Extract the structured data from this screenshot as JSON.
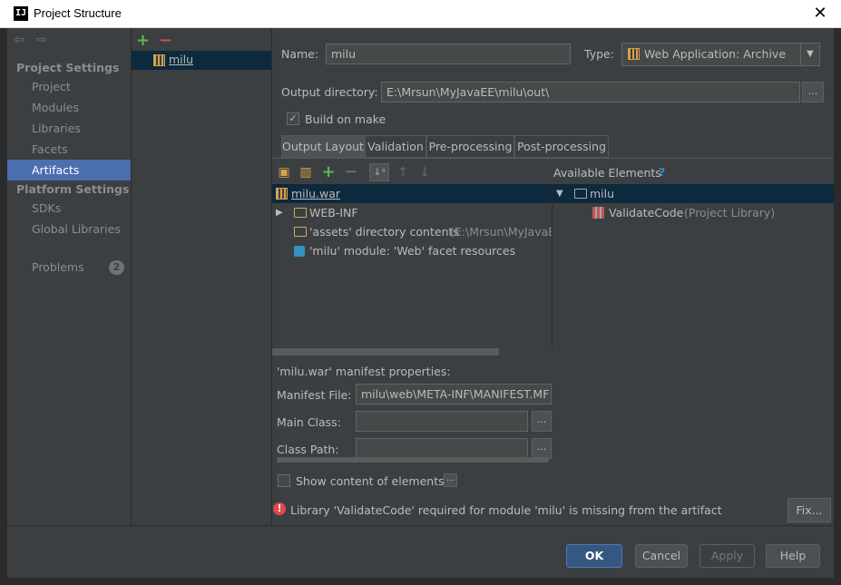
{
  "window": {
    "title": "Project Structure",
    "app_icon": "intellij-icon"
  },
  "sidebar": {
    "project_settings": "Project Settings",
    "items_project": [
      "Project",
      "Modules",
      "Libraries",
      "Facets",
      "Artifacts"
    ],
    "platform_settings": "Platform Settings",
    "items_platform": [
      "SDKs",
      "Global Libraries"
    ],
    "problems_label": "Problems",
    "problems_count": "2",
    "selected": "Artifacts"
  },
  "artifacts": {
    "add": "+",
    "remove": "−",
    "list": [
      "milu"
    ]
  },
  "form": {
    "name_label": "Name:",
    "name_value": "milu",
    "type_label": "Type:",
    "type_value": "Web Application: Archive",
    "output_label": "Output directory:",
    "output_value": "E:\\Mrsun\\MyJavaEE\\milu\\out\\",
    "build_on_make": "Build on make",
    "build_checked": true
  },
  "tabs": [
    "Output Layout",
    "Validation",
    "Pre-processing",
    "Post-processing"
  ],
  "layout_tree": {
    "root": "milu.war",
    "children": [
      {
        "label": "WEB-INF",
        "extra": ""
      },
      {
        "label": "'assets' directory contents",
        "extra": "(E:\\Mrsun\\MyJavaEE"
      },
      {
        "label": "'milu' module: 'Web' facet resources",
        "extra": ""
      }
    ]
  },
  "available": {
    "title": "Available Elements",
    "help": "?",
    "module": "milu",
    "library": "ValidateCode",
    "library_extra": "(Project Library)"
  },
  "manifest": {
    "header": "'milu.war' manifest properties:",
    "file_label": "Manifest File:",
    "file_value": "milu\\web\\META-INF\\MANIFEST.MF",
    "main_class_label": "Main Class:",
    "class_path_label": "Class Path:"
  },
  "show_content": "Show content of elements",
  "warning": "Library 'ValidateCode' required for module 'milu' is missing from the artifact",
  "fix_label": "Fix...",
  "buttons": {
    "ok": "OK",
    "cancel": "Cancel",
    "apply": "Apply",
    "help": "Help"
  }
}
